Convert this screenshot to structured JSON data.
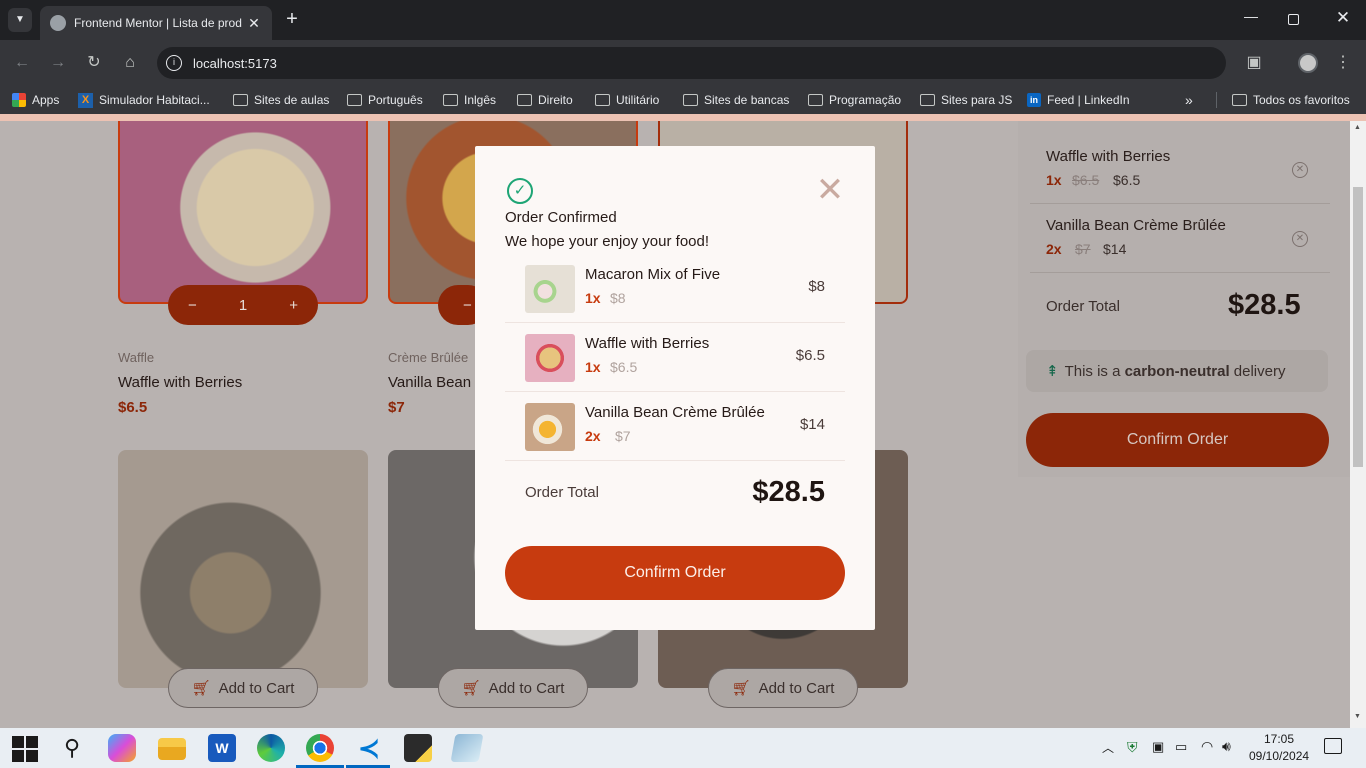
{
  "browser": {
    "tab_title": "Frontend Mentor | Lista de prod",
    "url": "localhost:5173",
    "bookmarks": [
      "Apps",
      "Simulador Habitaci...",
      "Sites de aulas",
      "Português",
      "Inlgês",
      "Direito",
      "Utilitário",
      "Sites de bancas",
      "Programação",
      "Sites para JS",
      "Feed | LinkedIn"
    ],
    "all_bookmarks": "Todos os favoritos"
  },
  "products": [
    {
      "category": "Waffle",
      "name": "Waffle with Berries",
      "price": "$6.5",
      "qty": "1"
    },
    {
      "category": "Crème Brûlée",
      "name": "Vanilla Bean",
      "price": "$7"
    }
  ],
  "add_to_cart": "Add to Cart",
  "cart": {
    "items": [
      {
        "name": "Waffle with Berries",
        "qty": "1x",
        "unit": "$6.5",
        "total": "$6.5"
      },
      {
        "name": "Vanilla Bean Crème Brûlée",
        "qty": "2x",
        "unit": "$7",
        "total": "$14"
      }
    ],
    "total_label": "Order Total",
    "total": "$28.5",
    "carbon_pre": "This is a ",
    "carbon_bold": "carbon-neutral",
    "carbon_post": " delivery",
    "confirm": "Confirm Order"
  },
  "modal": {
    "title": "Order Confirmed",
    "subtitle": "We hope your enjoy your food!",
    "items": [
      {
        "name": "Macaron Mix of Five",
        "qty": "1x",
        "unit": "$8",
        "total": "$8"
      },
      {
        "name": "Waffle with Berries",
        "qty": "1x",
        "unit": "$6.5",
        "total": "$6.5"
      },
      {
        "name": "Vanilla Bean Crème Brûlée",
        "qty": "2x",
        "unit": "$7",
        "total": "$14"
      }
    ],
    "total_label": "Order Total",
    "total": "$28.5",
    "confirm": "Confirm Order"
  },
  "taskbar": {
    "time": "17:05",
    "date": "09/10/2024"
  },
  "colors": {
    "accent": "#c73b0f",
    "green": "#1ea575"
  }
}
